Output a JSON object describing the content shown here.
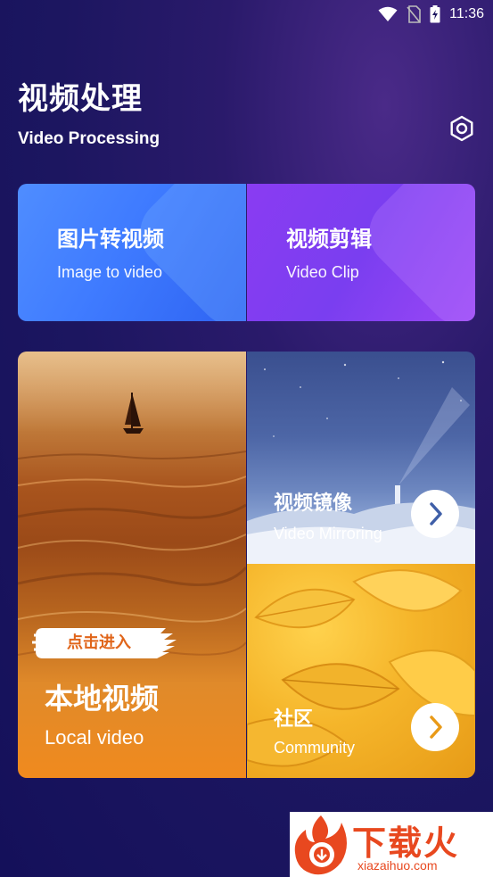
{
  "status_bar": {
    "time": "11:36",
    "icons": [
      "wifi-icon",
      "no-sim-icon",
      "battery-charging-icon"
    ]
  },
  "header": {
    "title_cn": "视频处理",
    "title_en": "Video Processing",
    "settings_icon": "settings-icon"
  },
  "cards": {
    "image_to_video": {
      "title_cn": "图片转视频",
      "title_en": "Image to video",
      "accent": "#3f7bff"
    },
    "video_clip": {
      "title_cn": "视频剪辑",
      "title_en": "Video Clip",
      "accent": "#7a3ef0"
    },
    "local_video": {
      "badge": "点击进入",
      "title_cn": "本地视频",
      "title_en": "Local video",
      "accent": "#f08a1e"
    },
    "video_mirroring": {
      "title_cn": "视频镜像",
      "title_en": "Video Mirroring",
      "arrow_icon": "chevron-right-icon"
    },
    "community": {
      "title_cn": "社区",
      "title_en": "Community",
      "arrow_icon": "chevron-right-icon"
    }
  },
  "watermark": {
    "brand": "下载火",
    "domain": "xiazaihuo.com",
    "color": "#e8481f"
  }
}
